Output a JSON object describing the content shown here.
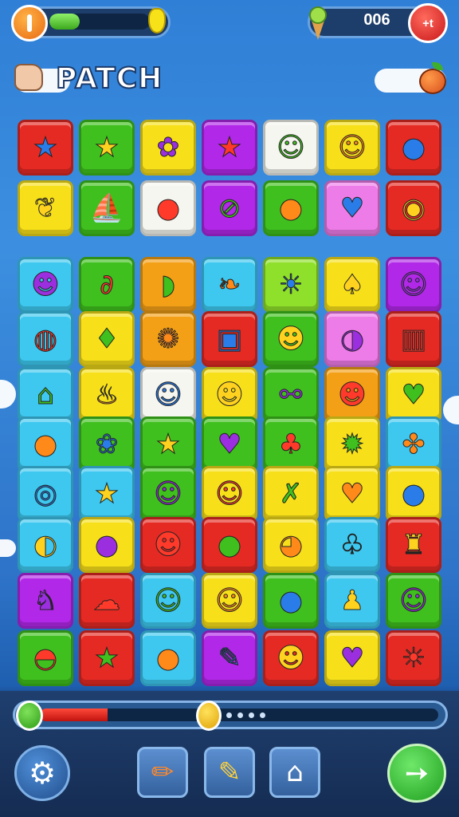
{
  "hud": {
    "pause_icon": "pause-icon",
    "energy_level": 0.3,
    "score": "006",
    "close_label": "+t"
  },
  "header": {
    "title": "PATCH"
  },
  "colors": {
    "red": "#e52a24",
    "green": "#3fc01e",
    "yellow": "#f7e01a",
    "purple": "#b128e8",
    "white": "#f6f6f0",
    "orange": "#f4a016",
    "cyan": "#3ec8f0",
    "pink": "#ee7ce8",
    "lime": "#8fe02a"
  },
  "board": {
    "rows": [
      [
        {
          "c": "red",
          "g": "★"
        },
        {
          "c": "green",
          "g": "★"
        },
        {
          "c": "yellow",
          "g": "✿"
        },
        {
          "c": "purple",
          "g": "★"
        },
        {
          "c": "white",
          "g": "☺"
        },
        {
          "c": "yellow",
          "g": "☺"
        },
        {
          "c": "red",
          "g": "●"
        }
      ],
      [
        {
          "c": "yellow",
          "g": "❦"
        },
        {
          "c": "green",
          "g": "⛵"
        },
        {
          "c": "white",
          "g": "●"
        },
        {
          "c": "purple",
          "g": "⊘"
        },
        {
          "c": "green",
          "g": "●"
        },
        {
          "c": "pink",
          "g": "♥"
        },
        {
          "c": "red",
          "g": "◉"
        }
      ],
      [
        {
          "c": "cyan",
          "g": "☻"
        },
        {
          "c": "green",
          "g": "∂"
        },
        {
          "c": "orange",
          "g": "◗"
        },
        {
          "c": "cyan",
          "g": "❧"
        },
        {
          "c": "lime",
          "g": "☀"
        },
        {
          "c": "yellow",
          "g": "♠"
        },
        {
          "c": "purple",
          "g": "☺"
        }
      ],
      [
        {
          "c": "cyan",
          "g": "◍"
        },
        {
          "c": "yellow",
          "g": "♦"
        },
        {
          "c": "orange",
          "g": "✺"
        },
        {
          "c": "red",
          "g": "▣"
        },
        {
          "c": "green",
          "g": "☻"
        },
        {
          "c": "pink",
          "g": "◑"
        },
        {
          "c": "red",
          "g": "▥"
        }
      ],
      [
        {
          "c": "cyan",
          "g": "⌂"
        },
        {
          "c": "yellow",
          "g": "♨"
        },
        {
          "c": "white",
          "g": "☺"
        },
        {
          "c": "yellow",
          "g": "☻"
        },
        {
          "c": "green",
          "g": "⚯"
        },
        {
          "c": "orange",
          "g": "☻"
        },
        {
          "c": "yellow",
          "g": "♥"
        }
      ],
      [
        {
          "c": "cyan",
          "g": "●"
        },
        {
          "c": "green",
          "g": "❀"
        },
        {
          "c": "green",
          "g": "★"
        },
        {
          "c": "green",
          "g": "♥"
        },
        {
          "c": "green",
          "g": "♣"
        },
        {
          "c": "yellow",
          "g": "✹"
        },
        {
          "c": "cyan",
          "g": "✤"
        }
      ],
      [
        {
          "c": "cyan",
          "g": "◎"
        },
        {
          "c": "cyan",
          "g": "★"
        },
        {
          "c": "green",
          "g": "☺"
        },
        {
          "c": "yellow",
          "g": "☺"
        },
        {
          "c": "yellow",
          "g": "✗"
        },
        {
          "c": "yellow",
          "g": "♥"
        },
        {
          "c": "yellow",
          "g": "●"
        }
      ],
      [
        {
          "c": "cyan",
          "g": "◐"
        },
        {
          "c": "yellow",
          "g": "●"
        },
        {
          "c": "red",
          "g": "☻"
        },
        {
          "c": "red",
          "g": "●"
        },
        {
          "c": "yellow",
          "g": "◕"
        },
        {
          "c": "cyan",
          "g": "♧"
        },
        {
          "c": "red",
          "g": "♜"
        }
      ],
      [
        {
          "c": "purple",
          "g": "♞"
        },
        {
          "c": "red",
          "g": "☁"
        },
        {
          "c": "cyan",
          "g": "☺"
        },
        {
          "c": "yellow",
          "g": "☺"
        },
        {
          "c": "green",
          "g": "●"
        },
        {
          "c": "cyan",
          "g": "♟"
        },
        {
          "c": "green",
          "g": "☺"
        }
      ],
      [
        {
          "c": "green",
          "g": "◓"
        },
        {
          "c": "red",
          "g": "★"
        },
        {
          "c": "cyan",
          "g": "●"
        },
        {
          "c": "purple",
          "g": "✎"
        },
        {
          "c": "red",
          "g": "☻"
        },
        {
          "c": "yellow",
          "g": "♥"
        },
        {
          "c": "red",
          "g": "☀"
        }
      ]
    ]
  },
  "footer": {
    "level_progress": 0.17,
    "gear_icon": "gear-icon",
    "tools": [
      "✏",
      "✎",
      "⌂"
    ],
    "next_glyph": "➙"
  }
}
